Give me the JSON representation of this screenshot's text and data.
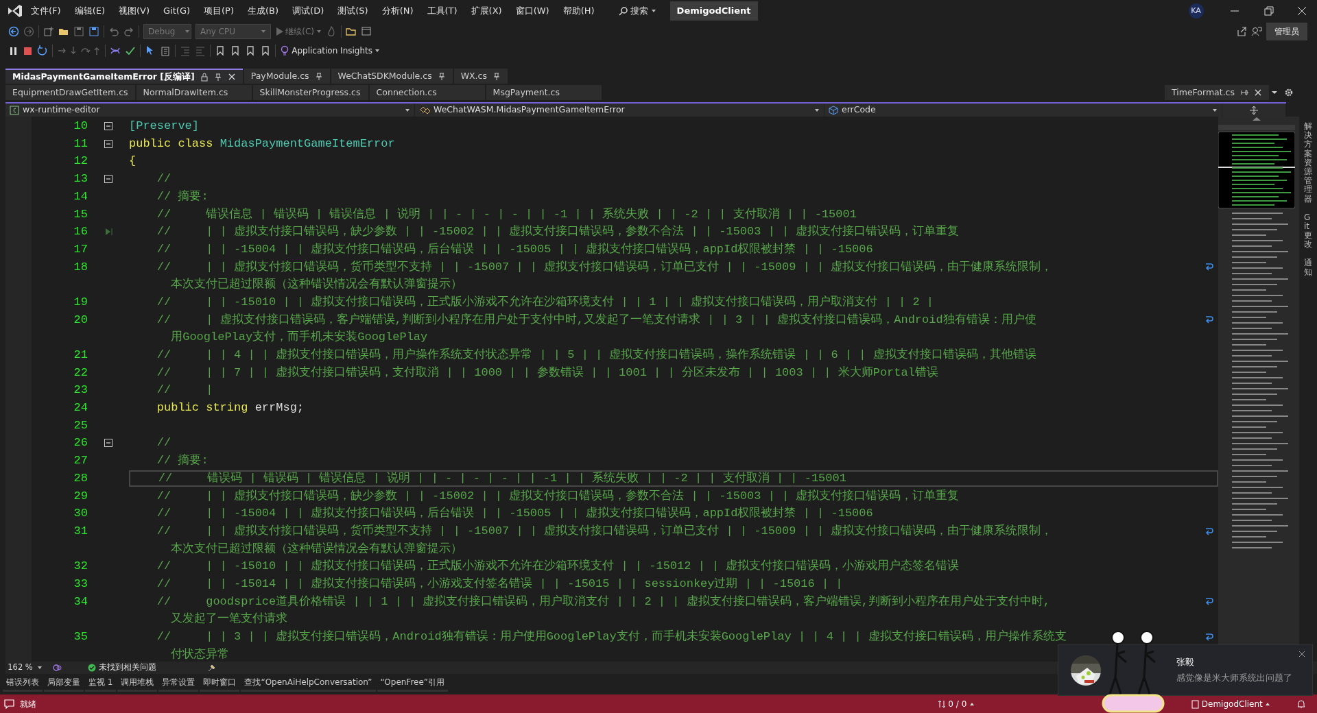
{
  "menu": [
    "文件(F)",
    "编辑(E)",
    "视图(V)",
    "Git(G)",
    "项目(P)",
    "生成(B)",
    "调试(D)",
    "测试(S)",
    "分析(N)",
    "工具(T)",
    "扩展(X)",
    "窗口(W)",
    "帮助(H)"
  ],
  "search": "搜索",
  "solution_name": "DemigodClient",
  "user_initials": "KA",
  "admin_label": "管理员",
  "toolbar": {
    "configuration": "Debug",
    "platform": "Any CPU",
    "continue": "继续(C)",
    "insights": "Application Insights"
  },
  "pinned_tabs": [
    {
      "label": "MidasPaymentGameItemError [反编译]",
      "selected": true
    },
    {
      "label": "PayModule.cs",
      "selected": false
    },
    {
      "label": "WeChatSDKModule.cs",
      "selected": false
    },
    {
      "label": "WX.cs",
      "selected": false
    }
  ],
  "tabs": [
    {
      "label": "EquipmentDrawGetItem.cs",
      "selected": false
    },
    {
      "label": "NormalDrawItem.cs",
      "selected": false
    },
    {
      "label": "SkillMonsterProgress.cs",
      "selected": false
    },
    {
      "label": "Connection.cs",
      "selected": false
    },
    {
      "label": "MsgPayment.cs",
      "selected": false
    }
  ],
  "right_tab": "TimeFormat.cs",
  "nav_bar": {
    "project": "wx-runtime-editor",
    "type": "WeChatWASM.MidasPaymentGameItemError",
    "member": "errCode"
  },
  "code_lines": [
    {
      "number": "10",
      "fold": true,
      "segments": [
        {
          "kind": "type",
          "text": "[Preserve]"
        }
      ]
    },
    {
      "number": "11",
      "fold": true,
      "segments": [
        {
          "kind": "keyword",
          "text": "public class "
        },
        {
          "kind": "type",
          "text": "MidasPaymentGameItemError"
        }
      ]
    },
    {
      "number": "12",
      "segments": [
        {
          "kind": "keyword",
          "text": "{"
        }
      ]
    },
    {
      "number": "13",
      "fold": true,
      "segments": [
        {
          "kind": "comment",
          "text": "    //"
        }
      ]
    },
    {
      "number": "14",
      "segments": [
        {
          "kind": "comment",
          "text": "    // 摘要:"
        }
      ]
    },
    {
      "number": "15",
      "segments": [
        {
          "kind": "comment",
          "text": "    //     错误信息 | 错误码 | 错误信息 | 说明 | | - | - | - | | -1 | | 系统失败 | | -2 | | 支付取消 | | -15001"
        }
      ]
    },
    {
      "number": "16",
      "step": true,
      "segments": [
        {
          "kind": "comment",
          "text": "    //     | | 虚拟支付接口错误码，缺少参数 | | -15002 | | 虚拟支付接口错误码，参数不合法 | | -15003 | | 虚拟支付接口错误码，订单重复"
        }
      ]
    },
    {
      "number": "17",
      "segments": [
        {
          "kind": "comment",
          "text": "    //     | | -15004 | | 虚拟支付接口错误码，后台错误 | | -15005 | | 虚拟支付接口错误码，appId权限被封禁 | | -15006"
        }
      ]
    },
    {
      "number": "18",
      "segments": [
        {
          "kind": "comment",
          "text": "    //     | | 虚拟支付接口错误码，货币类型不支持 | | -15007 | | 虚拟支付接口错误码，订单已支付 | | -15009 | | 虚拟支付接口错误码，由于健康系统限制，"
        }
      ],
      "wrap": "本次支付已超过限额（这种错误情况会有默认弹窗提示）"
    },
    {
      "number": "19",
      "segments": [
        {
          "kind": "comment",
          "text": "    //     | | -15010 | | 虚拟支付接口错误码，正式版小游戏不允许在沙箱环境支付 | | 1 | | 虚拟支付接口错误码，用户取消支付 | | 2 |"
        }
      ]
    },
    {
      "number": "20",
      "segments": [
        {
          "kind": "comment",
          "text": "    //     | 虚拟支付接口错误码，客户端错误,判断到小程序在用户处于支付中时,又发起了一笔支付请求 | | 3 | | 虚拟支付接口错误码，Android独有错误：用户使"
        }
      ],
      "wrap": "用GooglePlay支付，而手机未安装GooglePlay"
    },
    {
      "number": "21",
      "segments": [
        {
          "kind": "comment",
          "text": "    //     | | 4 | | 虚拟支付接口错误码，用户操作系统支付状态异常 | | 5 | | 虚拟支付接口错误码，操作系统错误 | | 6 | | 虚拟支付接口错误码，其他错误"
        }
      ]
    },
    {
      "number": "22",
      "segments": [
        {
          "kind": "comment",
          "text": "    //     | | 7 | | 虚拟支付接口错误码，支付取消 | | 1000 | | 参数错误 | | 1001 | | 分区未发布 | | 1003 | | 米大师Portal错误"
        }
      ]
    },
    {
      "number": "23",
      "segments": [
        {
          "kind": "comment",
          "text": "    //     |"
        }
      ]
    },
    {
      "number": "24",
      "segments": [
        {
          "kind": "keyword",
          "text": "    public string "
        },
        {
          "kind": "plain",
          "text": "errMsg;"
        }
      ]
    },
    {
      "number": "25"
    },
    {
      "number": "26",
      "fold": true,
      "segments": [
        {
          "kind": "comment",
          "text": "    //"
        }
      ]
    },
    {
      "number": "27",
      "segments": [
        {
          "kind": "comment",
          "text": "    // 摘要:"
        }
      ]
    },
    {
      "number": "28",
      "current": true,
      "segments": [
        {
          "kind": "comment",
          "text": "    //     错误码 | 错误码 | 错误信息 | 说明 | | - | - | - | | -1 | | 系统失败 | | -2 | | 支付取消 | | -15001"
        }
      ]
    },
    {
      "number": "29",
      "segments": [
        {
          "kind": "comment",
          "text": "    //     | | 虚拟支付接口错误码，缺少参数 | | -15002 | | 虚拟支付接口错误码，参数不合法 | | -15003 | | 虚拟支付接口错误码，订单重复"
        }
      ]
    },
    {
      "number": "30",
      "segments": [
        {
          "kind": "comment",
          "text": "    //     | | -15004 | | 虚拟支付接口错误码，后台错误 | | -15005 | | 虚拟支付接口错误码，appId权限被封禁 | | -15006"
        }
      ]
    },
    {
      "number": "31",
      "segments": [
        {
          "kind": "comment",
          "text": "    //     | | 虚拟支付接口错误码，货币类型不支持 | | -15007 | | 虚拟支付接口错误码，订单已支付 | | -15009 | | 虚拟支付接口错误码，由于健康系统限制，"
        }
      ],
      "wrap": "本次支付已超过限额（这种错误情况会有默认弹窗提示）"
    },
    {
      "number": "32",
      "segments": [
        {
          "kind": "comment",
          "text": "    //     | | -15010 | | 虚拟支付接口错误码，正式版小游戏不允许在沙箱环境支付 | | -15012 | | 虚拟支付接口错误码，小游戏用户态签名错误"
        }
      ]
    },
    {
      "number": "33",
      "segments": [
        {
          "kind": "comment",
          "text": "    //     | | -15014 | | 虚拟支付接口错误码，小游戏支付签名错误 | | -15015 | | sessionkey过期 | | -15016 | |"
        }
      ]
    },
    {
      "number": "34",
      "segments": [
        {
          "kind": "comment",
          "text": "    //     goodsprice道具价格错误 | | 1 | | 虚拟支付接口错误码，用户取消支付 | | 2 | | 虚拟支付接口错误码，客户端错误,判断到小程序在用户处于支付中时,"
        }
      ],
      "wrap": "又发起了一笔支付请求"
    },
    {
      "number": "35",
      "segments": [
        {
          "kind": "comment",
          "text": "    //     | | 3 | | 虚拟支付接口错误码，Android独有错误：用户使用GooglePlay支付，而手机未安装GooglePlay | | 4 | | 虚拟支付接口错误码，用户操作系统支"
        }
      ],
      "wrap": "付状态异常"
    }
  ],
  "side_tabs": [
    "解决方案资源管理器",
    "Git 更改",
    "通知"
  ],
  "editor_status": {
    "zoom": "162 %",
    "issues": "未找到相关问题"
  },
  "tool_tabs": [
    "错误列表",
    "局部变量",
    "监视 1",
    "调用堆栈",
    "异常设置",
    "即时窗口",
    "查找“OpenAiHelpConversation”",
    "“OpenFree”引用"
  ],
  "status_bar": {
    "message": "就绪",
    "sync": "0 / 0",
    "branch": "DemigodClient"
  },
  "notification": {
    "sender": "张毅",
    "message": "感觉像是米大师系统出问题了"
  }
}
